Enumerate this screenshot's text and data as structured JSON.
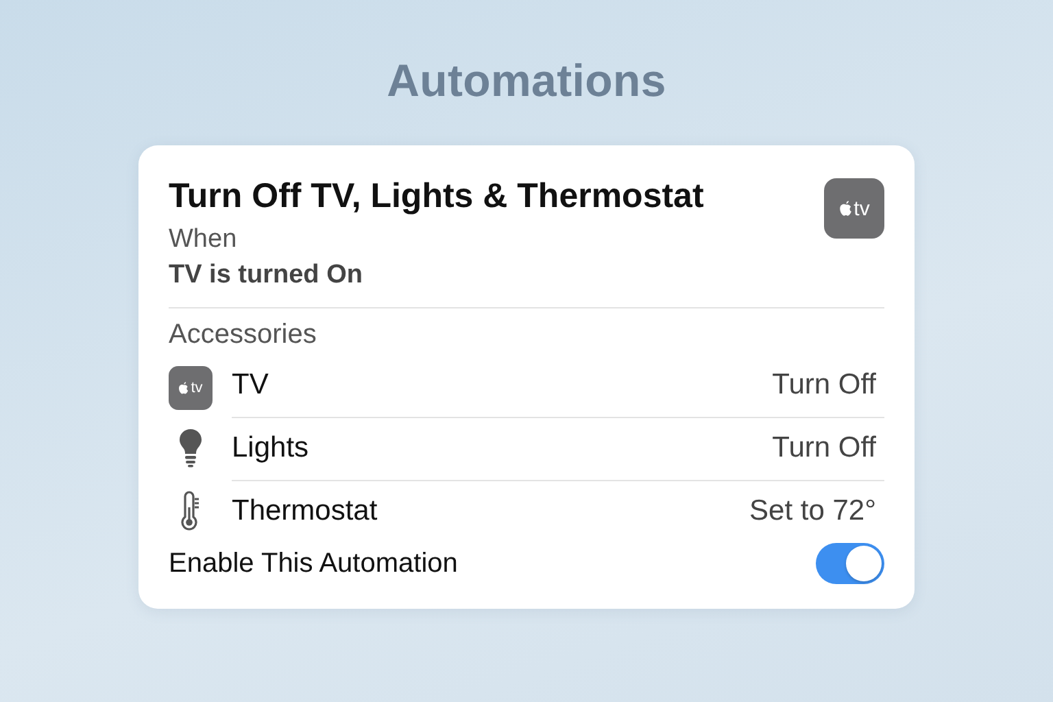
{
  "page_title": "Automations",
  "automation": {
    "title": "Turn Off TV, Lights & Thermostat",
    "badge": {
      "kind": "tv",
      "text": "tv"
    },
    "trigger_label": "When",
    "trigger": "TV is turned On",
    "section_label": "Accessories",
    "accessories": [
      {
        "kind": "tv",
        "badge_text": "tv",
        "name": "TV",
        "action": "Turn Off"
      },
      {
        "kind": "bulb",
        "name": "Lights",
        "action": "Turn Off"
      },
      {
        "kind": "thermometer",
        "name": "Thermostat",
        "action": "Set to 72°"
      }
    ],
    "enable": {
      "label": "Enable This Automation",
      "on": true
    }
  }
}
